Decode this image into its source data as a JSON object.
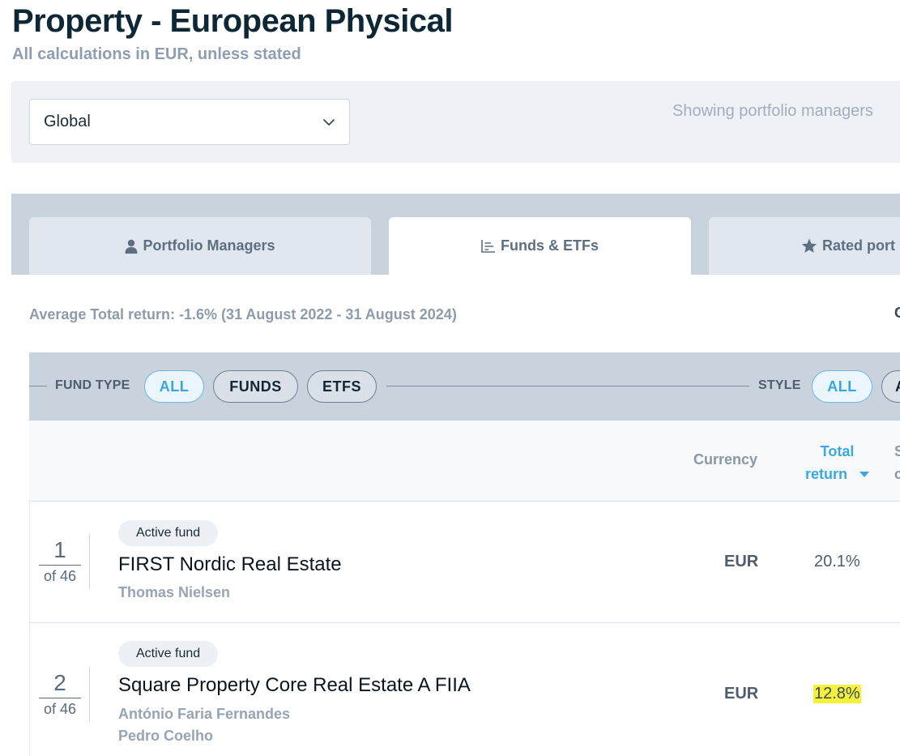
{
  "header": {
    "title": "Property - European Physical",
    "subtitle": "All calculations in EUR, unless stated"
  },
  "filter": {
    "region_value": "Global",
    "showing_text": "Showing portfolio managers"
  },
  "tabs": [
    {
      "label": "Portfolio Managers",
      "icon": "user-icon"
    },
    {
      "label": "Funds & ETFs",
      "icon": "chart-icon",
      "active": true
    },
    {
      "label": "Rated port",
      "icon": "star-icon"
    }
  ],
  "summary": {
    "avg_text": "Average Total return: -1.6% (31 August 2022 - 31 August 2024)",
    "right_char": "C"
  },
  "type_bar": {
    "fund_type_label": "FUND TYPE",
    "fund_type_options": [
      "ALL",
      "FUNDS",
      "ETFS"
    ],
    "style_label": "STYLE",
    "style_options": [
      "ALL",
      "A"
    ]
  },
  "table": {
    "columns": {
      "currency": "Currency",
      "total_return_line1": "Total",
      "total_return_line2": "return",
      "next_col_line1": "S",
      "next_col_line2": "c"
    },
    "rows": [
      {
        "rank": "1",
        "of": "of 46",
        "badge": "Active fund",
        "name": "FIRST Nordic Real Estate",
        "managers": [
          "Thomas Nielsen"
        ],
        "currency": "EUR",
        "total_return": "20.1%"
      },
      {
        "rank": "2",
        "of": "of 46",
        "badge": "Active fund",
        "name": "Square Property Core Real Estate A FIIA",
        "managers": [
          "António Faria Fernandes",
          "Pedro Coelho"
        ],
        "currency": "EUR",
        "total_return": "12.8%",
        "highlighted": true
      }
    ]
  },
  "colors": {
    "accent": "#3ba8e0",
    "highlight": "#f5f13a",
    "title": "#0e2735"
  }
}
